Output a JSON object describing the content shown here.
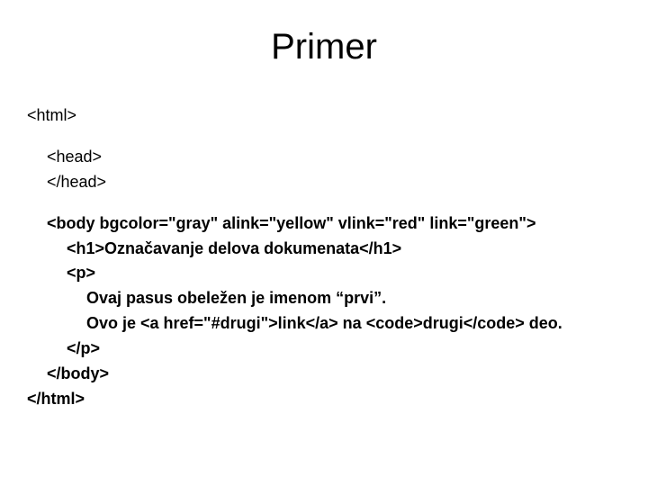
{
  "title": "Primer",
  "lines": {
    "l1": "<html>",
    "l2": "<head>",
    "l3": "</head>",
    "l4": "<body bgcolor=\"gray\" alink=\"yellow\" vlink=\"red\" link=\"green\">",
    "l5": "<h1>Označavanje delova dokumenata</h1>",
    "l6": "<p>",
    "l7": "Ovaj pasus obeležen je imenom “prvi”.",
    "l8": "Ovo je <a href=\"#drugi\">link</a> na <code>drugi</code> deo.",
    "l9": "</p>",
    "l10": "</body>",
    "l11": "</html>"
  }
}
